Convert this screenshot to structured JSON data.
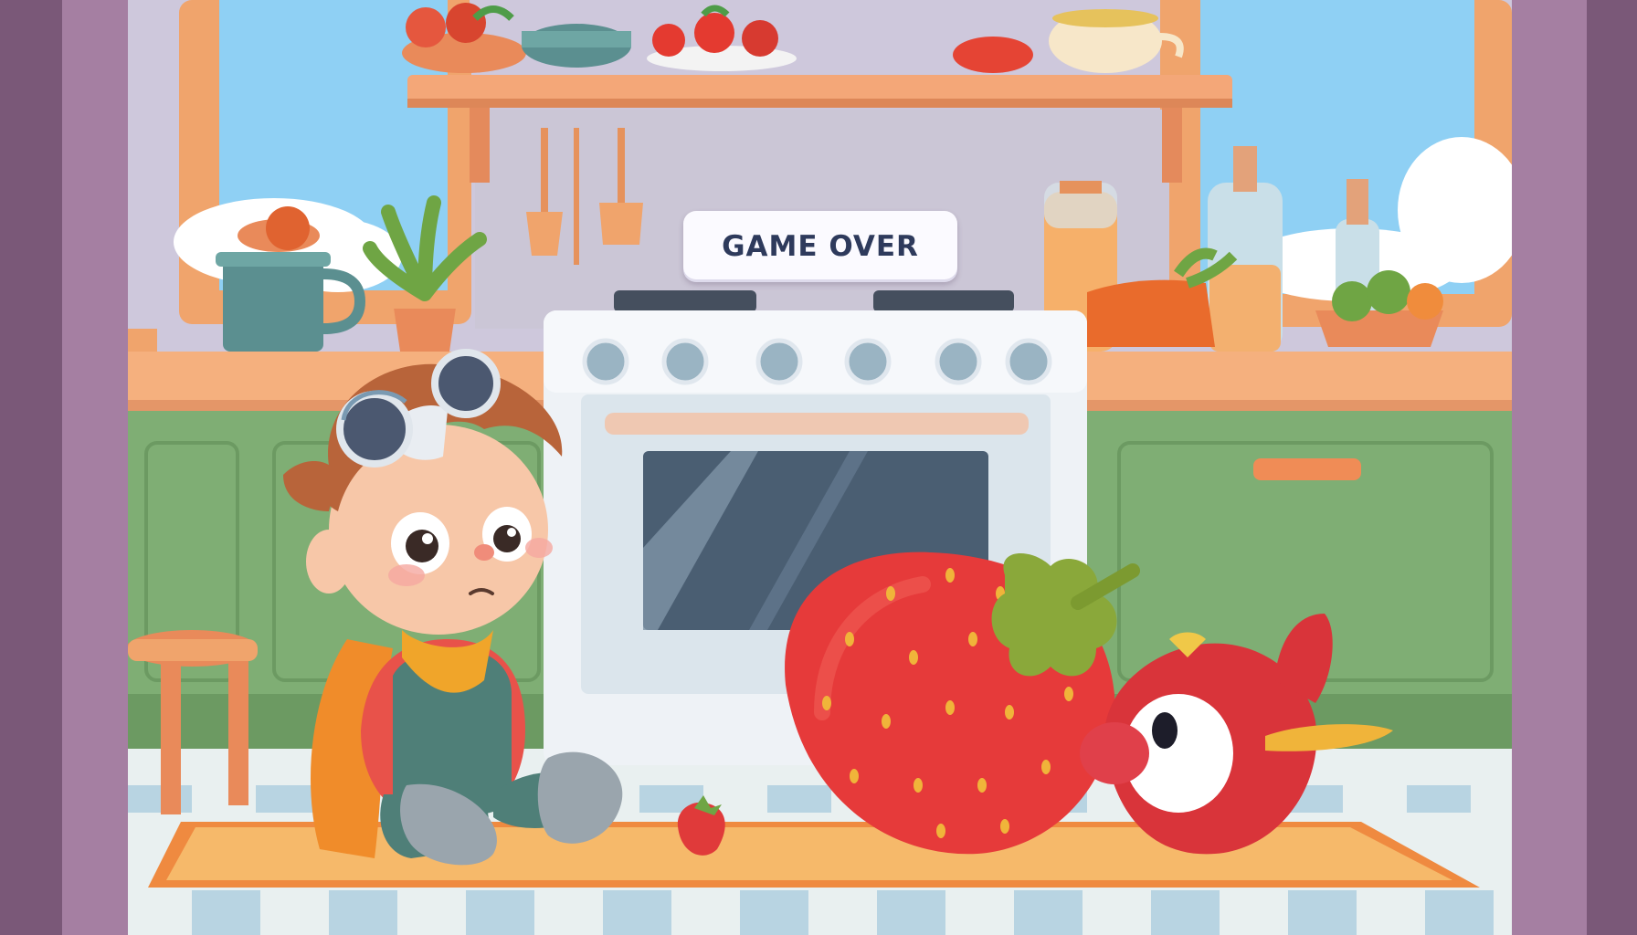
{
  "overlay": {
    "game_over_text": "GAME OVER"
  },
  "scene": {
    "setting": "kitchen",
    "colors": {
      "wall": "#c9c3d6",
      "sky": "#8fd0f4",
      "window_frame": "#f0a46c",
      "cabinet": "#7fae74",
      "countertop": "#f5b07e",
      "oven": "#eef2f6",
      "rug": "#f6b96a",
      "rug_border": "#ef8a40",
      "strawberry": "#e63a3a",
      "door_frame": "#7a5878"
    }
  },
  "characters": {
    "player": "boy-with-goggles-and-cape",
    "opponent": "red-toy-plane",
    "item": "giant-strawberry"
  }
}
